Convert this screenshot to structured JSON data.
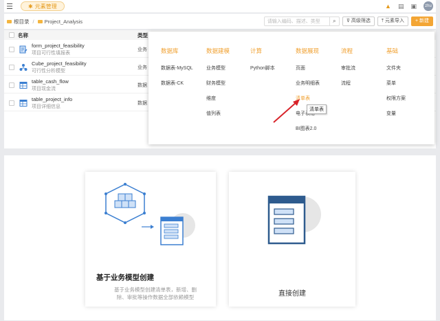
{
  "topbar": {
    "app_tab": "元素管理",
    "avatar": "zhu"
  },
  "toolbar": {
    "breadcrumb_root": "根目录",
    "breadcrumb_sep": "/",
    "breadcrumb_current": "Project_Analysis",
    "search_placeholder": "请输入编码、描述、类型",
    "advanced_filter": "高级筛选",
    "import_label": "元素导入",
    "new_label": "+ 新建"
  },
  "table": {
    "col_name": "名称",
    "col_type": "类型",
    "rows": [
      {
        "name": "form_project_feasibility",
        "desc": "项目可行性填报表",
        "type": "业务"
      },
      {
        "name": "Cube_project_feasibility",
        "desc": "可行性分析模型",
        "type": "业务"
      },
      {
        "name": "table_cash_flow",
        "desc": "项目现金流",
        "type": "数据"
      },
      {
        "name": "table_project_info",
        "desc": "项目详细信息",
        "type": "数据"
      }
    ]
  },
  "menu": {
    "columns": [
      {
        "title": "数据库",
        "items": [
          "数据表-MySQL",
          "数据表-CK"
        ]
      },
      {
        "title": "数据建模",
        "items": [
          "业务模型",
          "财务模型",
          "维度",
          "值列表"
        ]
      },
      {
        "title": "计算",
        "items": [
          "Python脚本"
        ]
      },
      {
        "title": "数据展现",
        "items": [
          "页面",
          "业务明细表",
          "清单表",
          "电子表格",
          "BI图表2.0"
        ]
      },
      {
        "title": "流程",
        "items": [
          "审批流",
          "流程"
        ]
      },
      {
        "title": "基础",
        "items": [
          "文件夹",
          "菜单",
          "权限方案",
          "变量"
        ]
      }
    ],
    "tooltip": "清单表"
  },
  "cards": {
    "card1_title": "基于业务模型创建",
    "card1_desc_line1": "基于业务模型创建清单表，新增、删",
    "card1_desc_line2": "除、审批等操作数据全部依赖模型",
    "card2_title": "直接创建"
  },
  "colors": {
    "accent": "#f0a030",
    "icon_blue": "#3b7fd1"
  }
}
